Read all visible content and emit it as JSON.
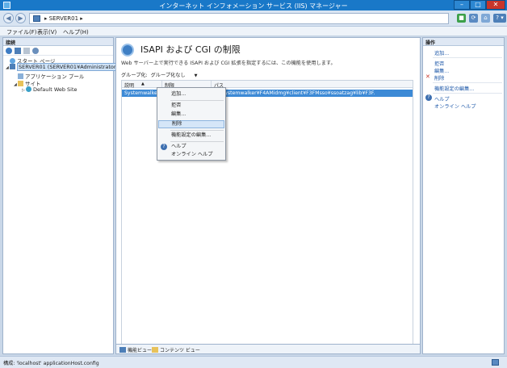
{
  "window": {
    "title": "インターネット インフォメーション サービス (IIS) マネージャー",
    "min": "–",
    "max": "□",
    "close": "✕"
  },
  "address": {
    "back": "◀",
    "forward": "▶",
    "path": "▸ SERVER01 ▸",
    "server": "SERVER01"
  },
  "toolbar": {
    "icons": [
      "stop-icon",
      "refresh-icon",
      "home-icon",
      "help-icon"
    ],
    "help_label": "? ▾"
  },
  "menu": [
    "ファイル(F)",
    "表示(V)",
    "ヘルプ(H)"
  ],
  "connections": {
    "header": "接続",
    "tree": [
      {
        "label": "スタート ページ",
        "level": 0,
        "icon": "start-page-icon"
      },
      {
        "label": "SERVER01 (SERVER01¥Administrator)",
        "level": 0,
        "icon": "server-icon",
        "expander": "◢",
        "selected": true
      },
      {
        "label": "アプリケーション プール",
        "level": 1,
        "icon": "app-pool-icon"
      },
      {
        "label": "サイト",
        "level": 1,
        "icon": "sites-folder-icon",
        "expander": "◢"
      },
      {
        "label": "Default Web Site",
        "level": 2,
        "icon": "globe-icon",
        "expander": "▷"
      }
    ]
  },
  "feature": {
    "title": "ISAPI および CGI の制限",
    "description": "Web サーバー上で実行できる ISAPI および CGI 拡張を指定するには、この機能を使用します。",
    "groupby_label": "グループ化:",
    "groupby_value": "グループ化なし",
    "columns": [
      "説明",
      "制限",
      "パス"
    ],
    "sort_indicator": "▲",
    "rows": [
      {
        "description": "Systemwalke...",
        "restriction": "許可",
        "path": "C:¥Systemwalker¥F4AMidmg¥client¥F3FMsso¥ssoatzag¥lib¥F3F..."
      }
    ]
  },
  "context_menu": {
    "items": [
      {
        "label": "追加...",
        "icon": ""
      },
      {
        "label": "拒否",
        "icon": ""
      },
      {
        "label": "編集...",
        "icon": ""
      },
      {
        "label": "削除",
        "icon": "✕",
        "highlighted": true
      },
      {
        "label": "機能設定の編集...",
        "icon": ""
      },
      {
        "label": "ヘルプ",
        "icon": "?"
      },
      {
        "label": "オンライン ヘルプ",
        "icon": ""
      }
    ]
  },
  "views": {
    "features": "機能ビュー",
    "content": "コンテンツ ビュー"
  },
  "actions": {
    "header": "操作",
    "items": [
      {
        "label": "追加...",
        "icon": ""
      },
      {
        "label": "拒否",
        "icon": ""
      },
      {
        "label": "編集...",
        "icon": ""
      },
      {
        "label": "削除",
        "icon": "✕"
      },
      {
        "label": "機能設定の編集...",
        "icon": ""
      },
      {
        "label": "ヘルプ",
        "icon": "?"
      },
      {
        "label": "オンライン ヘルプ",
        "icon": ""
      }
    ]
  },
  "status": {
    "text": "構成: 'localhost' applicationHost.config"
  },
  "colors": {
    "titlebar": "#1978c8",
    "selection": "#3d8ad6",
    "link": "#1c57a8",
    "delete": "#c7352a"
  }
}
